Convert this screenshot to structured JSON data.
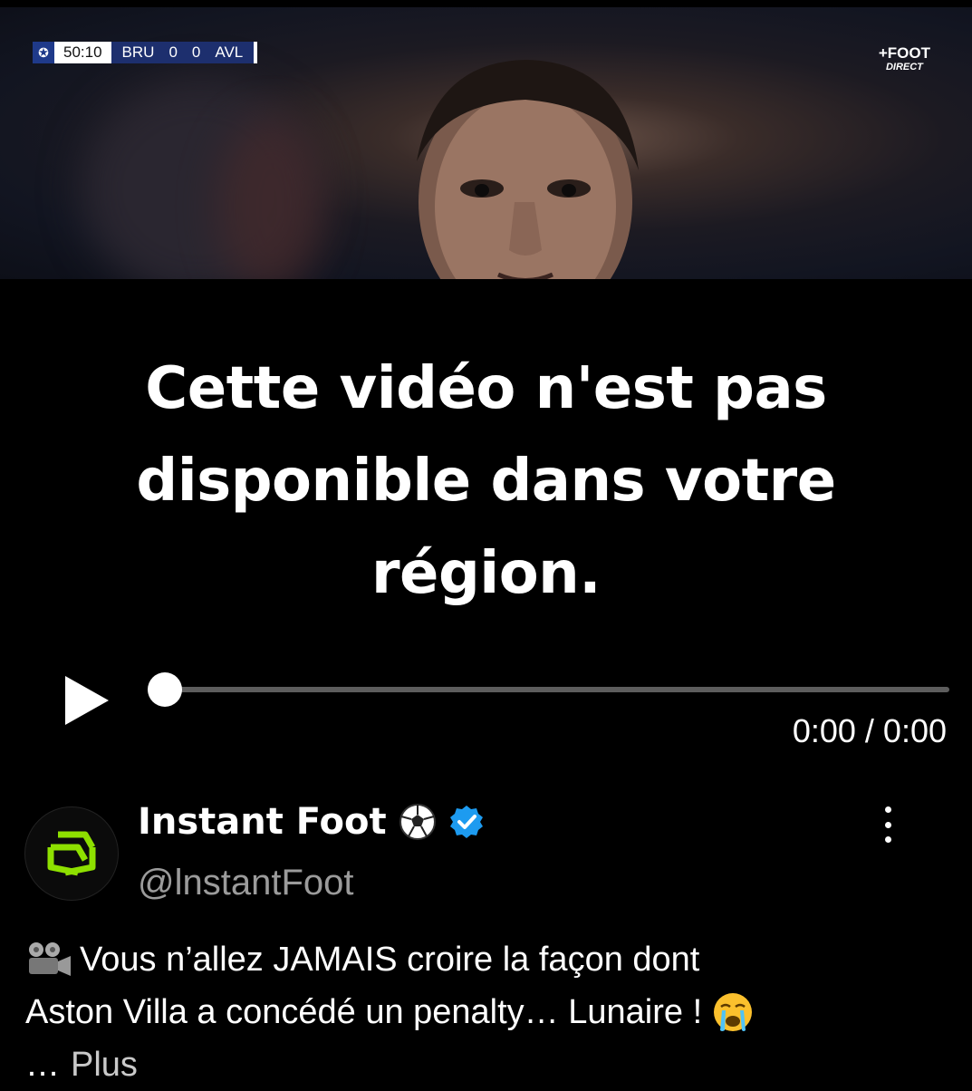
{
  "video": {
    "scoreboard": {
      "time": "50:10",
      "home_team": "BRU",
      "home_score": "0",
      "away_score": "0",
      "away_team": "AVL"
    },
    "channel_logo": {
      "line1": "+FOOT",
      "line2": "DIRECT"
    },
    "unavailable_message": "Cette vidéo n'est pas disponible dans votre région.",
    "player": {
      "play_icon": "play-icon",
      "time": "0:00 / 0:00",
      "progress": 0
    }
  },
  "tweet": {
    "author": {
      "display_name": "Instant Foot",
      "name_emoji": "soccer-ball-icon",
      "verified_icon": "verified-badge-icon",
      "handle": "@lnstantFoot",
      "avatar_icon": "instant-foot-logo-icon"
    },
    "more_icon": "more-vertical-icon",
    "lead_icon": "movie-camera-icon",
    "text_line1": "Vous n’allez JAMAIS croire la façon dont",
    "text_line2": "Aston Villa a concédé un penalty… Lunaire !",
    "trailing_icon": "crying-face-icon",
    "ellipsis": "…",
    "more_label": "Plus"
  },
  "colors": {
    "background": "#000000",
    "text": "#ffffff",
    "secondary_text": "#9b9b9b",
    "verified_blue": "#1d9bf0",
    "logo_green": "#8ee000"
  }
}
